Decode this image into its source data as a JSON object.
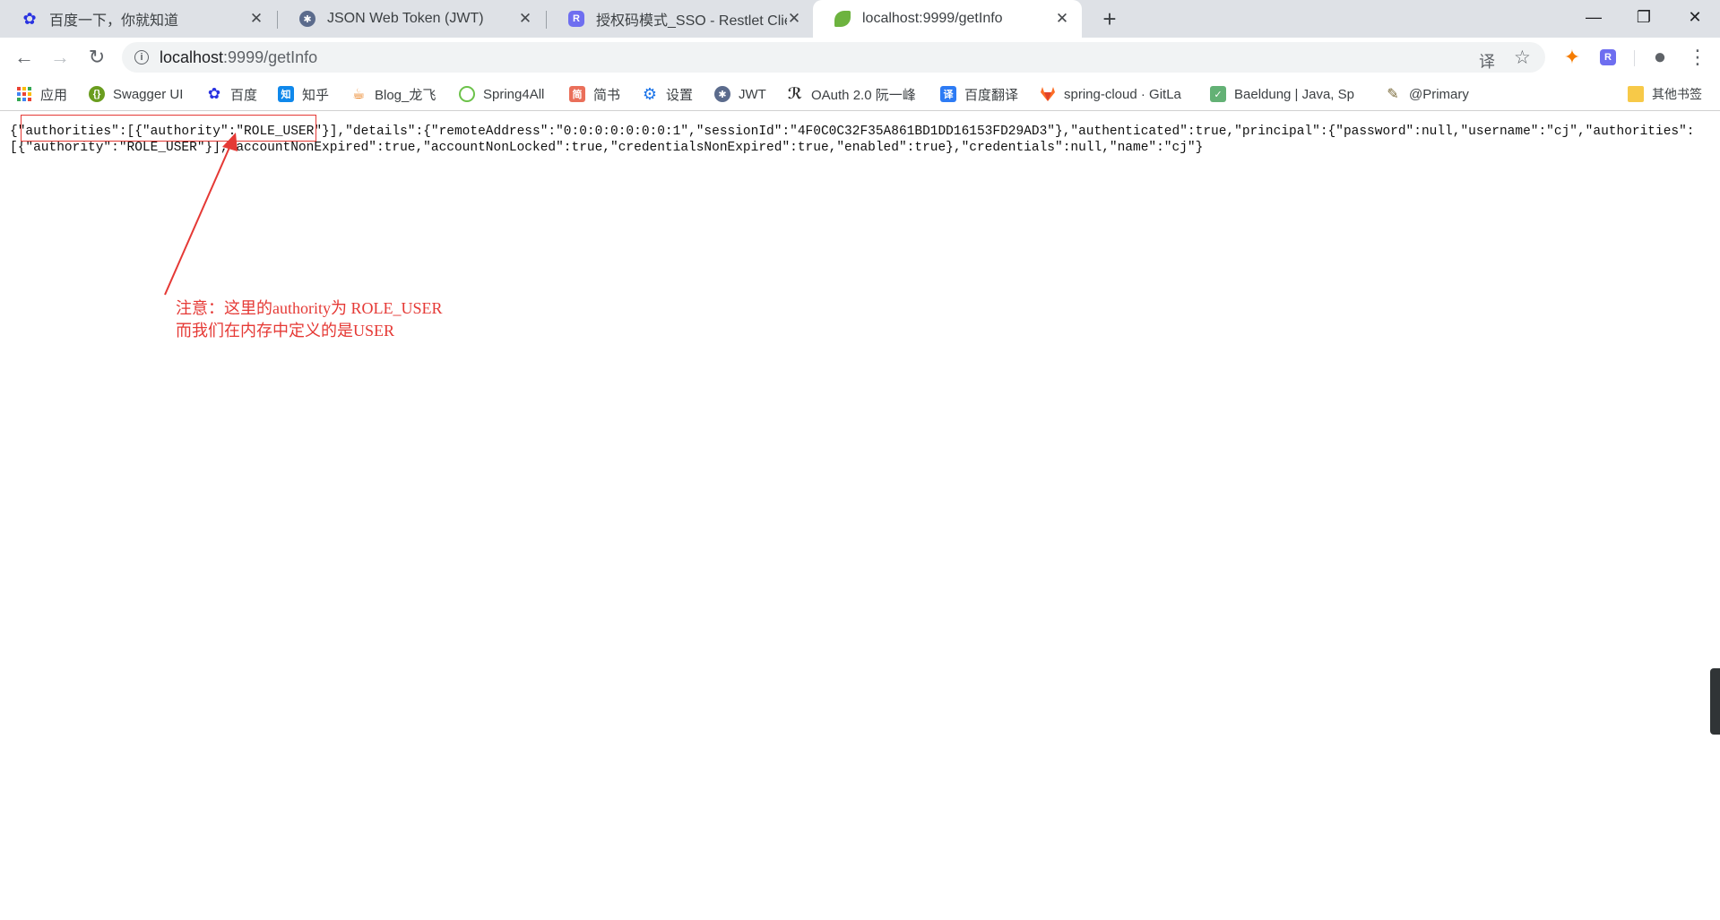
{
  "tabs": [
    {
      "title": "百度一下，你就知道",
      "icon": "baidu-paw-icon",
      "active": false
    },
    {
      "title": "JSON Web Token (JWT)",
      "icon": "jwt-icon",
      "active": false
    },
    {
      "title": "授权码模式_SSO - Restlet Client",
      "icon": "restlet-icon",
      "active": false
    },
    {
      "title": "localhost:9999/getInfo",
      "icon": "spring-leaf-icon",
      "active": true
    }
  ],
  "tab_close_glyph": "✕",
  "new_tab_glyph": "+",
  "window_controls": {
    "minimize": "—",
    "restore": "❐",
    "close": "✕"
  },
  "nav": {
    "back": "←",
    "forward": "→",
    "reload": "↻"
  },
  "address": {
    "info": "i",
    "host": "localhost",
    "path": ":9999/getInfo"
  },
  "address_icons": {
    "translate": "译",
    "star": "☆"
  },
  "extensions": {
    "ext1": "✦",
    "ext2": "R",
    "profile": "●",
    "menu": "⋮"
  },
  "bookmarks": [
    {
      "label": "应用",
      "icon": "apps-grid-icon"
    },
    {
      "label": "Swagger UI",
      "icon": "swagger-icon"
    },
    {
      "label": "百度",
      "icon": "baidu-paw-icon"
    },
    {
      "label": "知乎",
      "icon": "zhihu-icon"
    },
    {
      "label": "Blog_龙飞",
      "icon": "java-icon"
    },
    {
      "label": "Spring4All",
      "icon": "spring4all-icon"
    },
    {
      "label": "简书",
      "icon": "jianshu-icon"
    },
    {
      "label": "设置",
      "icon": "gear-icon"
    },
    {
      "label": "JWT",
      "icon": "jwt-icon"
    },
    {
      "label": "OAuth 2.0 阮一峰",
      "icon": "oauth-icon"
    },
    {
      "label": "百度翻译",
      "icon": "translate-icon"
    },
    {
      "label": "spring-cloud · GitLa",
      "icon": "gitlab-icon"
    },
    {
      "label": "Baeldung | Java, Sp",
      "icon": "baeldung-icon"
    },
    {
      "label": "@Primary",
      "icon": "primary-icon"
    }
  ],
  "other_bookmarks": "其他书签",
  "json_response": {
    "line1": "{\"authorities\":[{\"authority\":\"ROLE_USER\"}],\"details\":{\"remoteAddress\":\"0:0:0:0:0:0:0:1\",\"sessionId\":\"4F0C0C32F35A861BD1DD16153FD29AD3\"},\"authenticated\":true,\"principal\":{\"password\":null,\"username\":\"cj\",\"authorities\":",
    "line2": "[{\"authority\":\"ROLE_USER\"}],\"accountNonExpired\":true,\"accountNonLocked\":true,\"credentialsNonExpired\":true,\"enabled\":true},\"credentials\":null,\"name\":\"cj\"}"
  },
  "annotation": {
    "line1": "注意：这里的authority为 ROLE_USER",
    "line2": "而我们在内存中定义的是USER",
    "color": "#e53935"
  }
}
